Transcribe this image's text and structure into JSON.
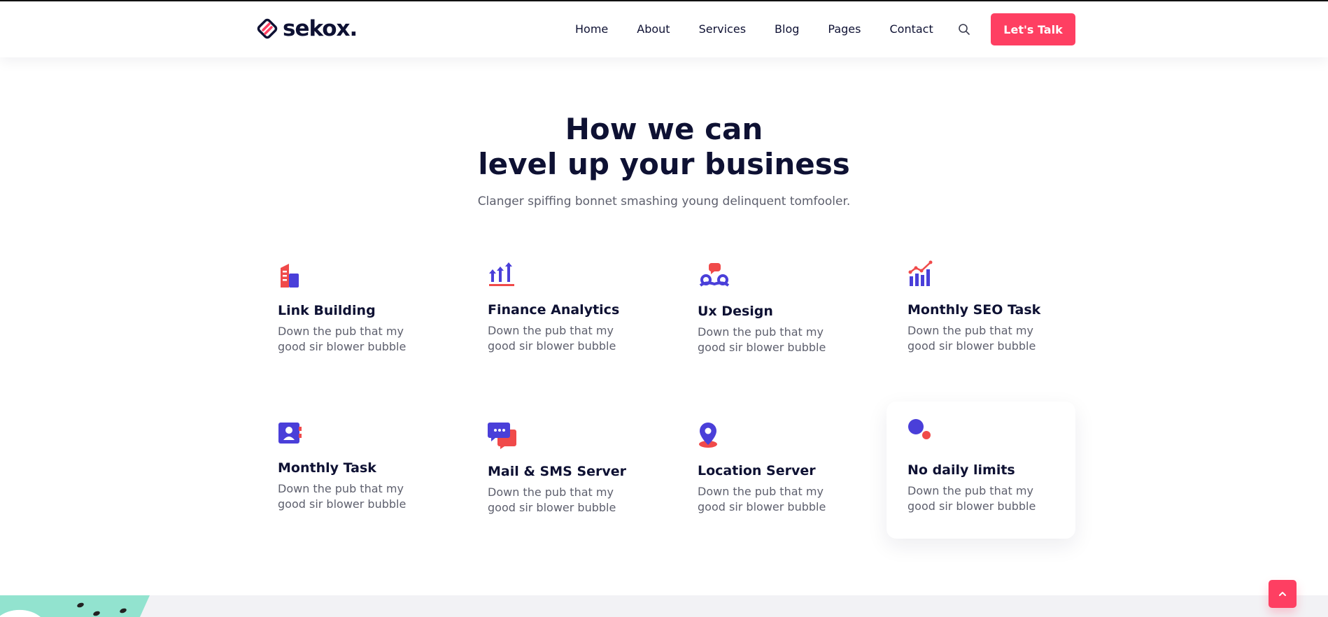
{
  "brand": {
    "name": "sekox."
  },
  "nav": {
    "items": [
      "Home",
      "About",
      "Services",
      "Blog",
      "Pages",
      "Contact"
    ],
    "search_icon": "search-icon",
    "cta_label": "Let's Talk"
  },
  "hero": {
    "title_line1": "How we can",
    "title_line2": "level up your business",
    "subtitle": "Clanger spiffing bonnet smashing young delinquent tomfooler."
  },
  "services": [
    {
      "title": "Link Building",
      "desc": "Down the pub that my good sir blower bubble",
      "icon": "building-icon"
    },
    {
      "title": "Finance Analytics",
      "desc": "Down the pub that my good sir blower bubble",
      "icon": "analytics-arrows-icon"
    },
    {
      "title": "Ux Design",
      "desc": "Down the pub that my good sir blower bubble",
      "icon": "ux-design-icon"
    },
    {
      "title": "Monthly SEO Task",
      "desc": "Down the pub that my good sir blower bubble",
      "icon": "chart-growth-icon"
    },
    {
      "title": "Monthly Task",
      "desc": "Down the pub that my good sir blower bubble",
      "icon": "contact-card-icon"
    },
    {
      "title": "Mail & SMS Server",
      "desc": "Down the pub that my good sir blower bubble",
      "icon": "chat-bubbles-icon"
    },
    {
      "title": "Location Server",
      "desc": "Down the pub that my good sir blower bubble",
      "icon": "location-pin-icon"
    },
    {
      "title": "No daily limits",
      "desc": "Down the pub that my good sir blower bubble",
      "icon": "dots-icon"
    }
  ],
  "colors": {
    "accent": "#fe3f62",
    "primary_blue": "#4a3fd9",
    "heading": "#0e1133",
    "text": "#5d5f6d",
    "icon_red": "#f04a4a",
    "blob_mint": "#92e3cf"
  },
  "back_to_top_icon": "chevron-up-icon"
}
